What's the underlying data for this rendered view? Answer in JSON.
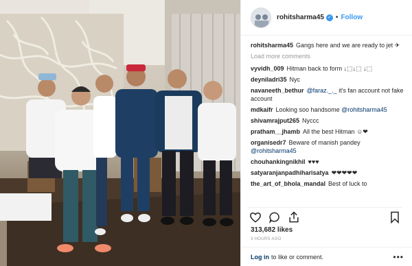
{
  "post": {
    "username": "rohitsharma45",
    "separator": "•",
    "follow_label": "Follow",
    "caption_user": "rohitsharma45",
    "caption_text": "Gangs here and we are ready to jet ✈",
    "load_more_label": "Load more comments",
    "likes": "313,682 likes",
    "time": "3 HOURS AGO"
  },
  "comments": [
    {
      "user": "vyvidh_009",
      "text": "Hitman back to form ↓⬚↓⬚ ↓⬚"
    },
    {
      "user": "deyniladri35",
      "text": "Nyc"
    },
    {
      "user": "navaneeth_bethur",
      "mention": "@faraz._._",
      "text": " it's fan account not fake account"
    },
    {
      "user": "mdkaifr",
      "text": "Looking soo handsome",
      "mention": "@rohitsharma45"
    },
    {
      "user": "shivamrajput265",
      "text": "Nyccc"
    },
    {
      "user": "pratham__jhamb",
      "text": "All the best Hitman ☺❤"
    },
    {
      "user": "organisedr7",
      "text": "Beware of manish pandey",
      "mention": "@rohitsharma45"
    },
    {
      "user": "chouhankingnikhil",
      "text": "♥♥♥"
    },
    {
      "user": "satyaranjanpadhiharisatya",
      "text": "❤❤❤❤❤"
    },
    {
      "user": "the_art_of_bhola_mandal",
      "text": "Best of luck to"
    }
  ],
  "footer": {
    "login_label": "Log in",
    "rest_text": "to like or comment.",
    "more_label": "•••"
  },
  "icons": [
    "heart-icon",
    "comment-icon",
    "share-icon",
    "bookmark-icon",
    "verified-icon"
  ],
  "colors": {
    "accent": "#3897f0",
    "link": "#003569",
    "muted": "#999999"
  }
}
